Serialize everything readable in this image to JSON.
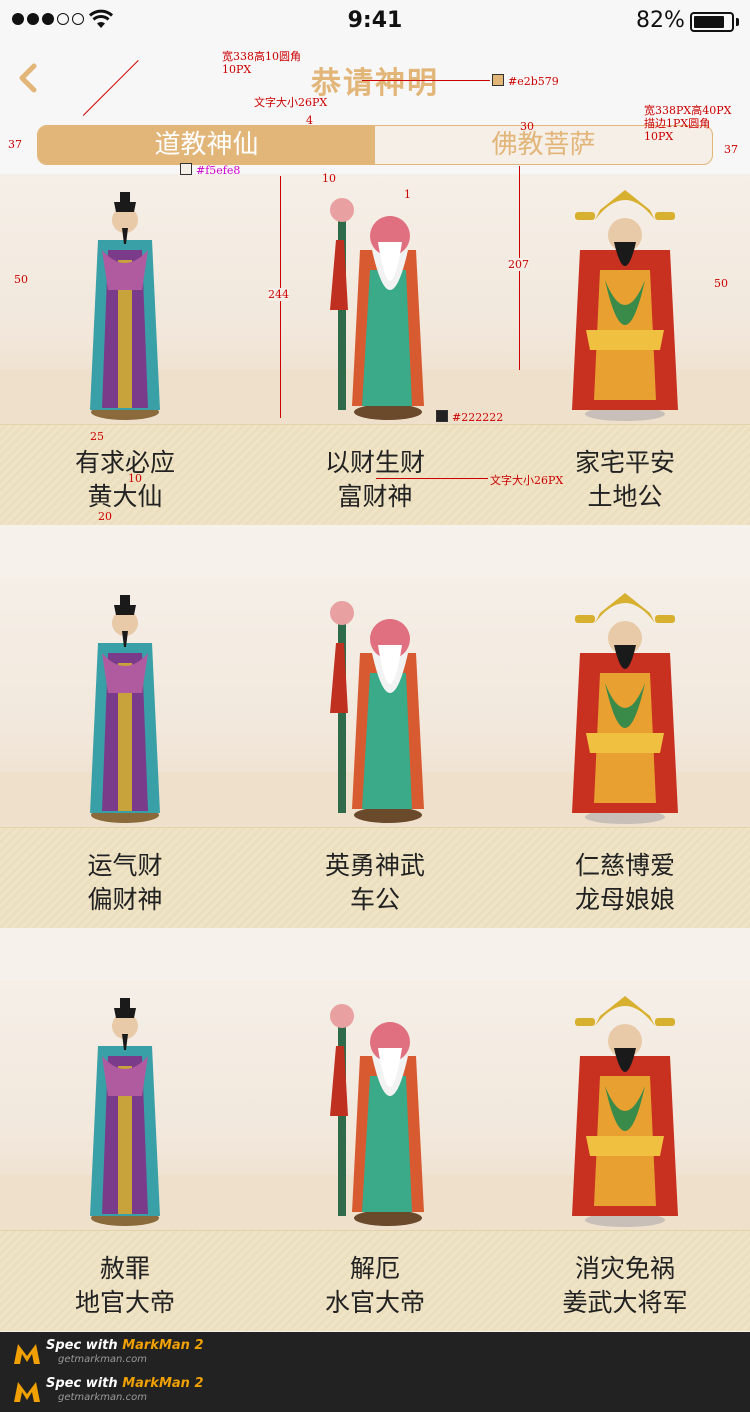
{
  "status_bar": {
    "time": "9:41",
    "battery": "82%",
    "battery_level": 0.82
  },
  "nav": {
    "title": "恭请神明",
    "back_icon": "chevron-left-icon"
  },
  "tabs": [
    {
      "label": "道教神仙",
      "active": true
    },
    {
      "label": "佛教菩萨",
      "active": false
    }
  ],
  "colors": {
    "accent": "#e2b579",
    "segment_bg": "#f5efe8",
    "text": "#222222"
  },
  "deities": [
    [
      {
        "line1": "有求必应",
        "line2": "黄大仙",
        "figure": "scholar-statue"
      },
      {
        "line1": "以财生财",
        "line2": "富财神",
        "figure": "longevity-statue"
      },
      {
        "line1": "家宅平安",
        "line2": "土地公",
        "figure": "wealth-god-statue"
      }
    ],
    [
      {
        "line1": "运气财",
        "line2": "偏财神",
        "figure": "scholar-statue"
      },
      {
        "line1": "英勇神武",
        "line2": "车公",
        "figure": "longevity-statue"
      },
      {
        "line1": "仁慈博爱",
        "line2": "龙母娘娘",
        "figure": "wealth-god-statue"
      }
    ],
    [
      {
        "line1": "赦罪",
        "line2": "地官大帝",
        "figure": "scholar-statue"
      },
      {
        "line1": "解厄",
        "line2": "水官大帝",
        "figure": "longevity-statue"
      },
      {
        "line1": "消灾免祸",
        "line2": "姜武大将军",
        "figure": "wealth-god-statue"
      }
    ]
  ],
  "annotations": {
    "title_color": "#e2b579",
    "segment_spec": [
      "宽338高10圆角",
      "10PX"
    ],
    "font_spec": "文字大小26PX",
    "border_spec": [
      "宽338PX高40PX",
      "描边1PX圆角",
      "10PX"
    ],
    "segment_bg_color": "#f5efe8",
    "text_color": "#222222",
    "label_font_spec": "文字大小26PX",
    "dims": {
      "margin_left": "37",
      "margin_right": "37",
      "gap_top": "4",
      "gap_right": "30",
      "fig_top": "10",
      "fig_line": "1",
      "fig_height": "244",
      "floor_height": "207",
      "side_left": "50",
      "side_right": "50",
      "label_gap": "25",
      "line_gap": "10",
      "bottom_gap": "20"
    }
  },
  "footer": {
    "items": [
      {
        "brand_prefix": "Spec with ",
        "brand": "MarkMan 2",
        "url": "getmarkman.com"
      },
      {
        "brand_prefix": "Spec with ",
        "brand": "MarkMan 2",
        "url": "getmarkman.com"
      }
    ]
  }
}
